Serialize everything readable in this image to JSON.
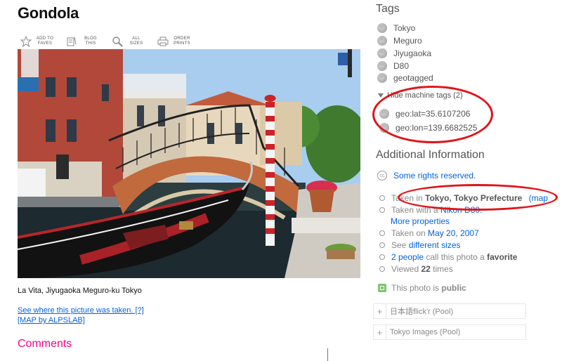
{
  "page": {
    "title": "Gondola",
    "toolbar": [
      {
        "label": "ADD TO FAVES",
        "icon": "star-icon"
      },
      {
        "label": "BLOG THIS",
        "icon": "blog-icon"
      },
      {
        "label": "ALL SIZES",
        "icon": "magnifier-icon"
      },
      {
        "label": "ORDER PRINTS",
        "icon": "printer-icon"
      }
    ],
    "caption": "La Vita, Jiyugaoka Meguro-ku Tokyo",
    "where_link": "See where this picture was taken. [?]",
    "map_link": "[MAP by ALPSLAB]",
    "comments_heading": "Comments"
  },
  "sidebar": {
    "tags_heading": "Tags",
    "tags": [
      "Tokyo",
      "Meguro",
      "Jiyugaoka",
      "D80",
      "geotagged"
    ],
    "hide_machine_tags": "Hide machine tags (2)",
    "machine_tags": [
      "geo:lat=35.6107206",
      "geo:lon=139.6682525"
    ],
    "additional_heading": "Additional Information",
    "rights": "Some rights reserved.",
    "taken_in_prefix": "Taken in ",
    "taken_in_place": "Tokyo, Tokyo Prefecture",
    "taken_in_map": "(map",
    "taken_with_prefix": "Taken with a ",
    "taken_with_camera": "Nikon D80.",
    "more_properties": "More properties",
    "taken_on_prefix": "Taken on ",
    "taken_on_date": "May 20, 2007",
    "see_prefix": "See ",
    "see_link": "different sizes",
    "fav_count_link": "2 people",
    "fav_middle": " call this photo a ",
    "fav_word": "favorite",
    "viewed_prefix": "Viewed ",
    "viewed_count": "22",
    "viewed_suffix": " times",
    "public_prefix": "This photo is ",
    "public_word": "public",
    "pools": [
      "日本語flick'r (Pool)",
      "Tokyo Images (Pool)"
    ]
  },
  "colors": {
    "link": "#0063dc",
    "comments": "#ff0084",
    "annotation_ring": "#e0141a"
  }
}
